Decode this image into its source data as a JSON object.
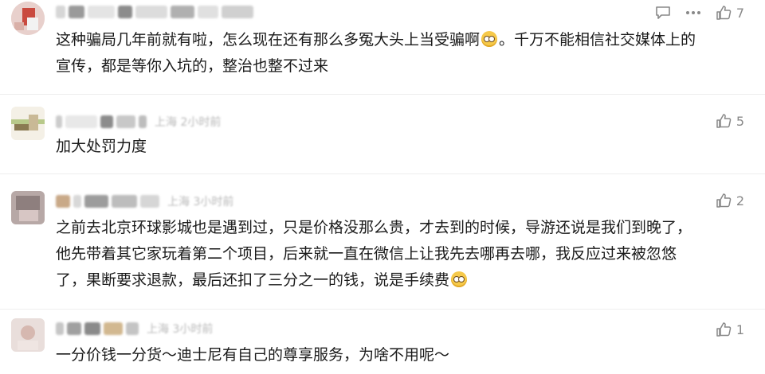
{
  "comments": [
    {
      "text_lines": [
        "这种骗局几年前就有啦，怎么现在还有那么多冤大头上当受骗啊",
        "。千万不能相信社交媒体上的",
        "宣传，都是等你入坑的，整治也整不过来"
      ],
      "likes": "7",
      "show_reply": true,
      "show_more": true
    },
    {
      "text_lines": [
        "加大处罚力度"
      ],
      "meta_text": "上海 2小时前",
      "likes": "5"
    },
    {
      "text_lines": [
        "之前去北京环球影城也是遇到过，只是价格没那么贵，才去到的时候，导游还说是我们到晚了，",
        "他先带着其它家玩着第二个项目，后来就一直在微信上让我先去哪再去哪，我反应过来被忽悠",
        "了，果断要求退款，最后还扣了三分之一的钱，说是手续费"
      ],
      "meta_text": "上海 3小时前",
      "likes": "2"
    },
    {
      "text_lines": [
        "一分价钱一分货～迪士尼有自己的尊享服务，为啥不用呢～"
      ],
      "meta_text": "上海 3小时前",
      "likes": "1"
    }
  ]
}
